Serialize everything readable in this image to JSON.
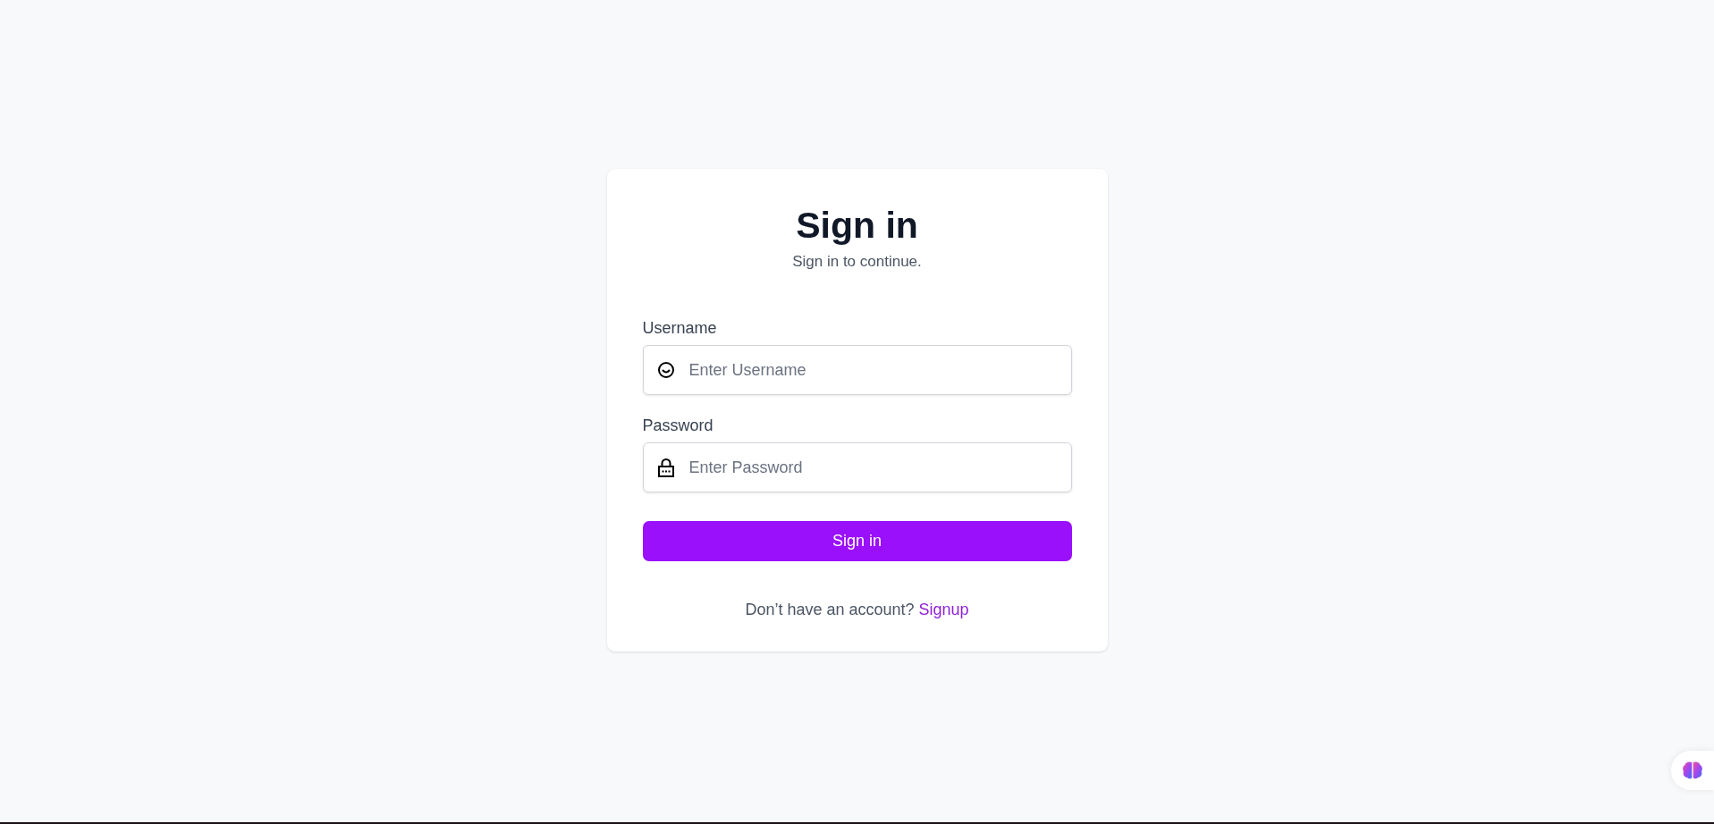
{
  "card": {
    "title": "Sign in",
    "subtitle": "Sign in to continue."
  },
  "fields": [
    {
      "kind": "username",
      "label": "Username",
      "placeholder": "Enter Username"
    },
    {
      "kind": "password",
      "label": "Password",
      "placeholder": "Enter Password"
    }
  ],
  "submit_button": "Sign in",
  "footer": {
    "text": "Don’t have an account?",
    "link": "Signup"
  }
}
